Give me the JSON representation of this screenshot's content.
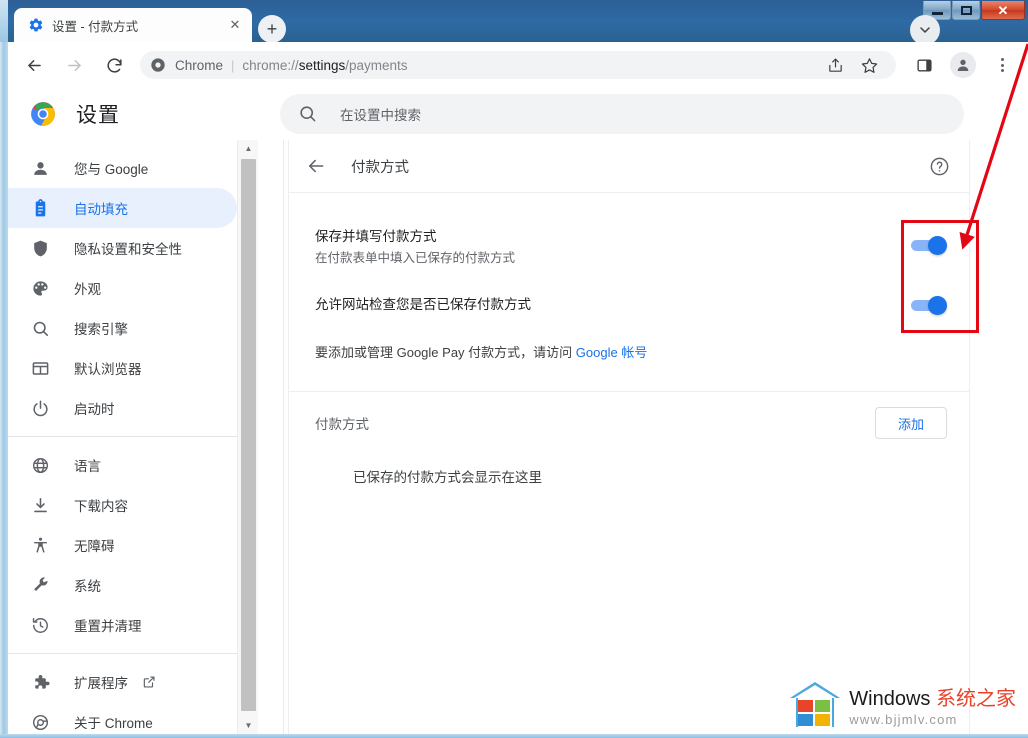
{
  "window": {
    "controls": {
      "minimize": "最小化",
      "maximize": "最大化",
      "close": "✕"
    }
  },
  "tabstrip": {
    "tab": {
      "favicon": "settings-gear-icon",
      "title": "设置 - 付款方式",
      "close_label": "✕"
    },
    "new_tab_label": "+",
    "tab_search_icon": "chevron-down-icon"
  },
  "toolbar": {
    "back_icon": "back-arrow-icon",
    "forward_icon": "forward-arrow-icon",
    "reload_icon": "reload-icon",
    "omnibox": {
      "page_icon": "chrome-security-icon",
      "scheme_label": "Chrome",
      "separator": "|",
      "url_prefix": "chrome://",
      "url_bold": "settings",
      "url_suffix": "/payments"
    },
    "share_icon": "share-icon",
    "bookmark_icon": "star-icon",
    "sidepanel_icon": "side-panel-icon",
    "profile_icon": "avatar-icon",
    "menu_icon": "three-dots-menu-icon"
  },
  "settings_header": {
    "logo": "chrome-logo-icon",
    "title": "设置",
    "search": {
      "icon": "search-icon",
      "placeholder": "在设置中搜索",
      "value": ""
    }
  },
  "sidebar": {
    "items": [
      {
        "icon": "person-icon",
        "label": "您与 Google",
        "active": false,
        "external": false
      },
      {
        "icon": "clipboard-icon",
        "label": "自动填充",
        "active": true,
        "external": false
      },
      {
        "icon": "shield-icon",
        "label": "隐私设置和安全性",
        "active": false,
        "external": false
      },
      {
        "icon": "palette-icon",
        "label": "外观",
        "active": false,
        "external": false
      },
      {
        "icon": "search-icon",
        "label": "搜索引擎",
        "active": false,
        "external": false
      },
      {
        "icon": "browser-icon",
        "label": "默认浏览器",
        "active": false,
        "external": false
      },
      {
        "icon": "power-icon",
        "label": "启动时",
        "active": false,
        "external": false
      }
    ],
    "items2": [
      {
        "icon": "globe-icon",
        "label": "语言",
        "active": false,
        "external": false
      },
      {
        "icon": "download-icon",
        "label": "下载内容",
        "active": false,
        "external": false
      },
      {
        "icon": "accessibility-icon",
        "label": "无障碍",
        "active": false,
        "external": false
      },
      {
        "icon": "wrench-icon",
        "label": "系统",
        "active": false,
        "external": false
      },
      {
        "icon": "restore-icon",
        "label": "重置并清理",
        "active": false,
        "external": false
      }
    ],
    "items3": [
      {
        "icon": "puzzle-icon",
        "label": "扩展程序",
        "active": false,
        "external": true
      },
      {
        "icon": "chrome-icon",
        "label": "关于 Chrome",
        "active": false,
        "external": false
      }
    ],
    "scrollbar": {
      "up_arrow": "▲",
      "down_arrow": "▼"
    }
  },
  "main": {
    "back_icon": "back-arrow-icon",
    "page_title": "付款方式",
    "help_icon": "help-circle-icon",
    "rows": [
      {
        "title": "保存并填写付款方式",
        "subtitle": "在付款表单中填入已保存的付款方式",
        "toggle_on": true
      },
      {
        "title": "允许网站检查您是否已保存付款方式",
        "subtitle": "",
        "toggle_on": true
      }
    ],
    "gpay_note": {
      "prefix": "要添加或管理 Google Pay 付款方式，请访问 ",
      "link": "Google 帐号"
    },
    "payment_section": {
      "heading": "付款方式",
      "add_button": "添加",
      "empty_text": "已保存的付款方式会显示在这里"
    }
  },
  "annotations": {
    "box_color": "#e30613",
    "arrow_color": "#e30613"
  },
  "watermark": {
    "brand_en": "Windows ",
    "brand_cn": "系统之家",
    "url": "www.bjjmlv.com"
  },
  "colors": {
    "accent_blue": "#1a73e8",
    "toggle_track": "#8ab4f8",
    "active_nav_bg": "#e8f0fe",
    "titlebar": "#2f6aa5",
    "annotation_red": "#e30613"
  }
}
